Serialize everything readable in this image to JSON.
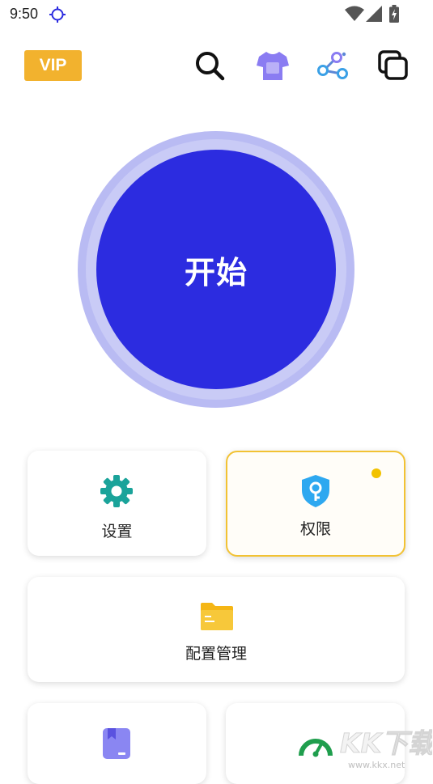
{
  "status_bar": {
    "time": "9:50"
  },
  "toolbar": {
    "vip_label": "VIP",
    "icons": [
      "search-icon",
      "tshirt-icon",
      "share-icon",
      "copy-icon"
    ]
  },
  "start_button": {
    "label": "开始"
  },
  "cards": {
    "settings": {
      "label": "设置",
      "icon": "gear-icon"
    },
    "permissions": {
      "label": "权限",
      "icon": "shield-key-icon",
      "has_notification": true
    },
    "config": {
      "label": "配置管理",
      "icon": "folder-icon"
    },
    "bottom_left": {
      "icon": "bookmark-icon"
    },
    "bottom_right": {
      "icon": "speedometer-icon"
    }
  },
  "watermark": {
    "brand": "KK下载",
    "url": "www.kkx.net"
  },
  "colors": {
    "accent": "#2c2ce0",
    "ring": "#b9bbf3",
    "vip": "#f2b22e",
    "highlight_border": "#f2c233",
    "gear": "#1aa39a",
    "shield": "#2ea8f0",
    "folder": "#f7c325",
    "bookmark": "#7c7cf0",
    "speedometer": "#1f9e4d"
  }
}
